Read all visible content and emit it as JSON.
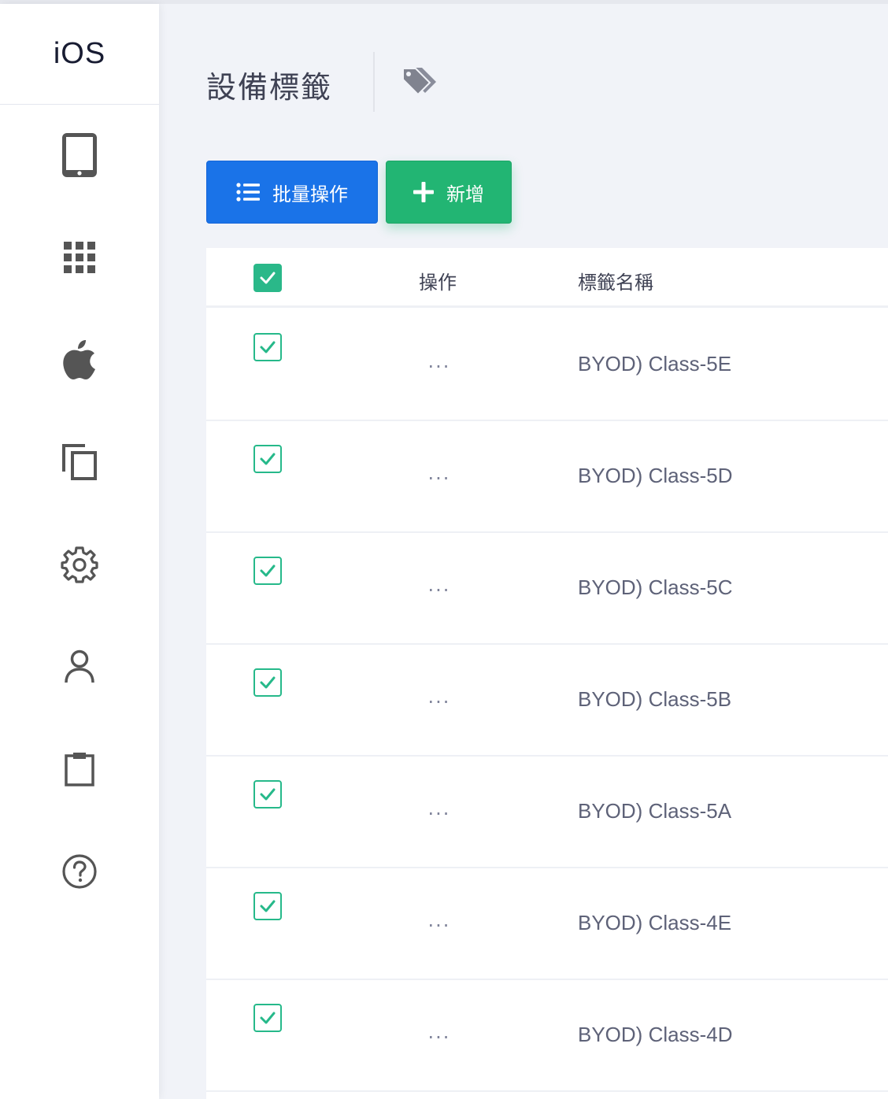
{
  "sidebar": {
    "brand": "iOS",
    "items": [
      {
        "icon": "tablet-icon"
      },
      {
        "icon": "apps-grid-icon"
      },
      {
        "icon": "apple-icon"
      },
      {
        "icon": "copy-icon"
      },
      {
        "icon": "gear-icon"
      },
      {
        "icon": "user-icon"
      },
      {
        "icon": "clipboard-icon"
      },
      {
        "icon": "help-icon"
      }
    ]
  },
  "header": {
    "title": "設備標籤",
    "icon": "tags-icon"
  },
  "toolbar": {
    "batch_label": "批量操作",
    "add_label": "新增"
  },
  "table": {
    "columns": [
      "操作",
      "標籤名稱"
    ],
    "action_label": "...",
    "rows": [
      {
        "name": "BYOD) Class-5E",
        "checked": true
      },
      {
        "name": "BYOD) Class-5D",
        "checked": true
      },
      {
        "name": "BYOD) Class-5C",
        "checked": true
      },
      {
        "name": "BYOD) Class-5B",
        "checked": true
      },
      {
        "name": "BYOD) Class-5A",
        "checked": true
      },
      {
        "name": "BYOD) Class-4E",
        "checked": true
      },
      {
        "name": "BYOD) Class-4D",
        "checked": true
      }
    ]
  },
  "colors": {
    "primary": "#1a73e8",
    "success": "#22b573",
    "check": "#2ab889"
  }
}
